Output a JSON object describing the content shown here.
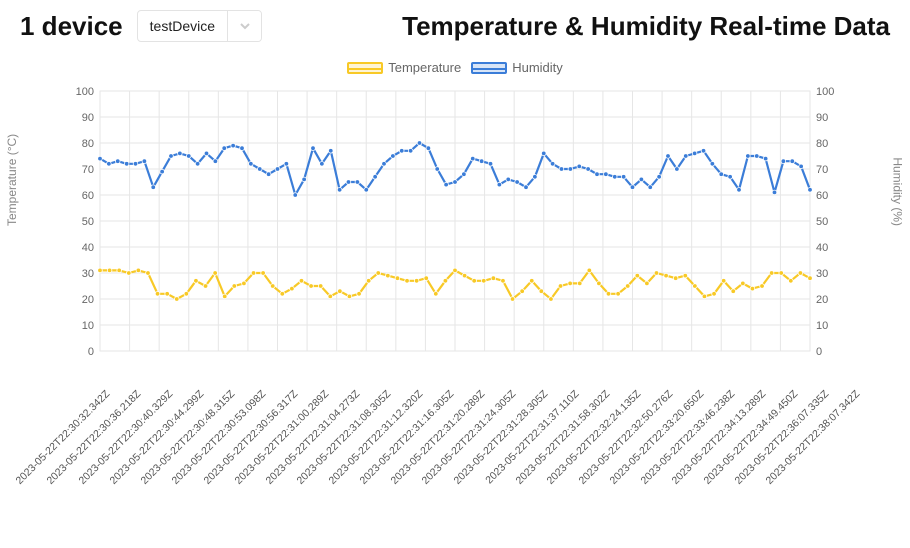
{
  "header": {
    "device_count_label": "1 device",
    "device_select_value": "testDevice"
  },
  "chart_title": "Temperature & Humidity Real-time Data",
  "legend": {
    "temp_label": "Temperature",
    "hum_label": "Humidity"
  },
  "colors": {
    "temperature": "#f8c926",
    "humidity": "#3b7dd8",
    "grid": "#e6e6e6",
    "axis": "#666"
  },
  "ylabel_left": "Temperature (°C)",
  "ylabel_right": "Humidity (%)",
  "chart_data": {
    "type": "line",
    "xlabel": "",
    "ylabel_left": "Temperature (°C)",
    "ylabel_right": "Humidity (%)",
    "ylim": [
      0,
      100
    ],
    "yticks": [
      0,
      10,
      20,
      30,
      40,
      50,
      60,
      70,
      80,
      90,
      100
    ],
    "categories": [
      "2023-05-22T22:30:32.342Z",
      "2023-05-22T22:30:36.218Z",
      "2023-05-22T22:30:40.329Z",
      "2023-05-22T22:30:44.299Z",
      "2023-05-22T22:30:48.315Z",
      "2023-05-22T22:30:53.098Z",
      "2023-05-22T22:30:56.317Z",
      "2023-05-22T22:31:00.289Z",
      "2023-05-22T22:31:04.273Z",
      "2023-05-22T22:31:08.305Z",
      "2023-05-22T22:31:12.320Z",
      "2023-05-22T22:31:16.305Z",
      "2023-05-22T22:31:20.289Z",
      "2023-05-22T22:31:24.305Z",
      "2023-05-22T22:31:28.305Z",
      "2023-05-22T22:31:37.110Z",
      "2023-05-22T22:31:58.302Z",
      "2023-05-22T22:32:24.135Z",
      "2023-05-22T22:32:50.276Z",
      "2023-05-22T22:33:20.650Z",
      "2023-05-22T22:33:46.238Z",
      "2023-05-22T22:34:13.289Z",
      "2023-05-22T22:34:49.450Z",
      "2023-05-22T22:36:07.335Z",
      "2023-05-22T22:38:07.342Z"
    ],
    "series": [
      {
        "name": "Temperature",
        "color": "#f8c926",
        "values": [
          31,
          31,
          31,
          30,
          31,
          30,
          22,
          22,
          20,
          22,
          27,
          25,
          30,
          21,
          25,
          26,
          30,
          30,
          25,
          22,
          24,
          27,
          25,
          25,
          21,
          23,
          21,
          22,
          27,
          30,
          29,
          28,
          27,
          27,
          28,
          22,
          27,
          31,
          29,
          27,
          27,
          28,
          27,
          20,
          23,
          27,
          23,
          20,
          25,
          26,
          26,
          31,
          26,
          22,
          22,
          25,
          29,
          26,
          30,
          29,
          28,
          29,
          25,
          21,
          22,
          27,
          23,
          26,
          24,
          25,
          30,
          30,
          27,
          30,
          28
        ]
      },
      {
        "name": "Humidity",
        "color": "#3b7dd8",
        "values": [
          74,
          72,
          73,
          72,
          72,
          73,
          63,
          69,
          75,
          76,
          75,
          72,
          76,
          73,
          78,
          79,
          78,
          72,
          70,
          68,
          70,
          72,
          60,
          66,
          78,
          72,
          77,
          62,
          65,
          65,
          62,
          67,
          72,
          75,
          77,
          77,
          80,
          78,
          70,
          64,
          65,
          68,
          74,
          73,
          72,
          64,
          66,
          65,
          63,
          67,
          76,
          72,
          70,
          70,
          71,
          70,
          68,
          68,
          67,
          67,
          63,
          66,
          63,
          67,
          75,
          70,
          75,
          76,
          77,
          72,
          68,
          67,
          62,
          75,
          75,
          74,
          61,
          73,
          73,
          71,
          62
        ]
      }
    ],
    "title": "Temperature & Humidity Real-time Data"
  }
}
